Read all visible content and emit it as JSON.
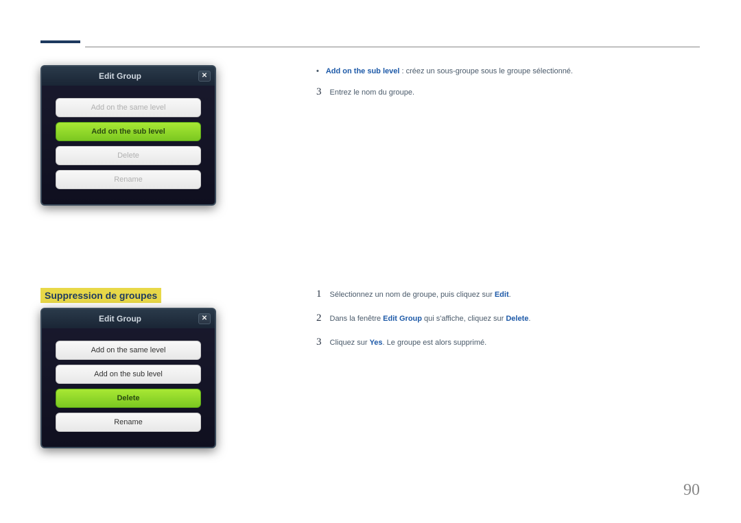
{
  "dialog1": {
    "title": "Edit Group",
    "btn1": "Add on the same level",
    "btn2": "Add on the sub level",
    "btn3": "Delete",
    "btn4": "Rename"
  },
  "dialog2": {
    "title": "Edit Group",
    "btn1": "Add on the same level",
    "btn2": "Add on the sub level",
    "btn3": "Delete",
    "btn4": "Rename"
  },
  "bullet": {
    "label": "Add on the sub level",
    "text": " : créez un sous-groupe sous le groupe sélectionné."
  },
  "step3a": {
    "num": "3",
    "text": "Entrez le nom du groupe."
  },
  "section": "Suppression de groupes",
  "step1b": {
    "num": "1",
    "text1": "Sélectionnez un nom de groupe, puis cliquez sur ",
    "edit": "Edit",
    "text2": "."
  },
  "step2b": {
    "num": "2",
    "text1": "Dans la fenêtre ",
    "eg": "Edit Group",
    "text2": " qui s'affiche, cliquez sur ",
    "del": "Delete",
    "text3": "."
  },
  "step3c": {
    "num": "3",
    "text1": "Cliquez sur ",
    "yes": "Yes",
    "text2": ". Le groupe est alors supprimé."
  },
  "pageNum": "90"
}
